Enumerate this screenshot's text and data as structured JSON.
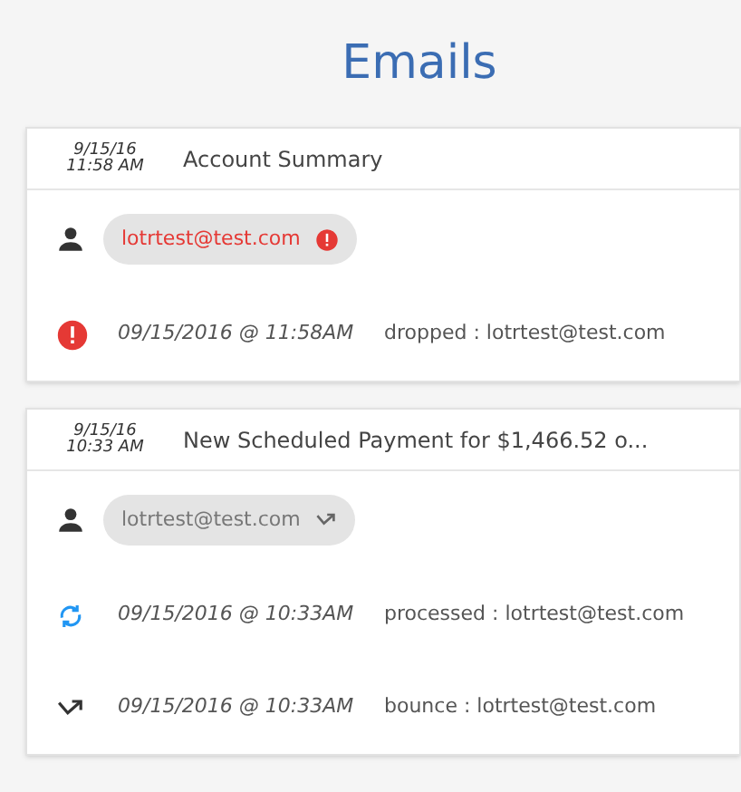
{
  "title": "Emails",
  "emails": [
    {
      "date": "9/15/16",
      "time": "11:58 AM",
      "subject": "Account Summary",
      "recipients": [
        {
          "address": "lotrtest@test.com",
          "kind": "dropped"
        }
      ],
      "events": [
        {
          "kind": "dropped",
          "timestamp": "09/15/2016 @ 11:58AM",
          "text": "dropped : lotrtest@test.com"
        }
      ]
    },
    {
      "date": "9/15/16",
      "time": "10:33 AM",
      "subject": "New Scheduled Payment for $1,466.52 o...",
      "recipients": [
        {
          "address": "lotrtest@test.com",
          "kind": "bounce"
        }
      ],
      "events": [
        {
          "kind": "processed",
          "timestamp": "09/15/2016 @ 10:33AM",
          "text": "processed : lotrtest@test.com"
        },
        {
          "kind": "bounce",
          "timestamp": "09/15/2016 @ 10:33AM",
          "text": "bounce : lotrtest@test.com"
        }
      ]
    }
  ]
}
